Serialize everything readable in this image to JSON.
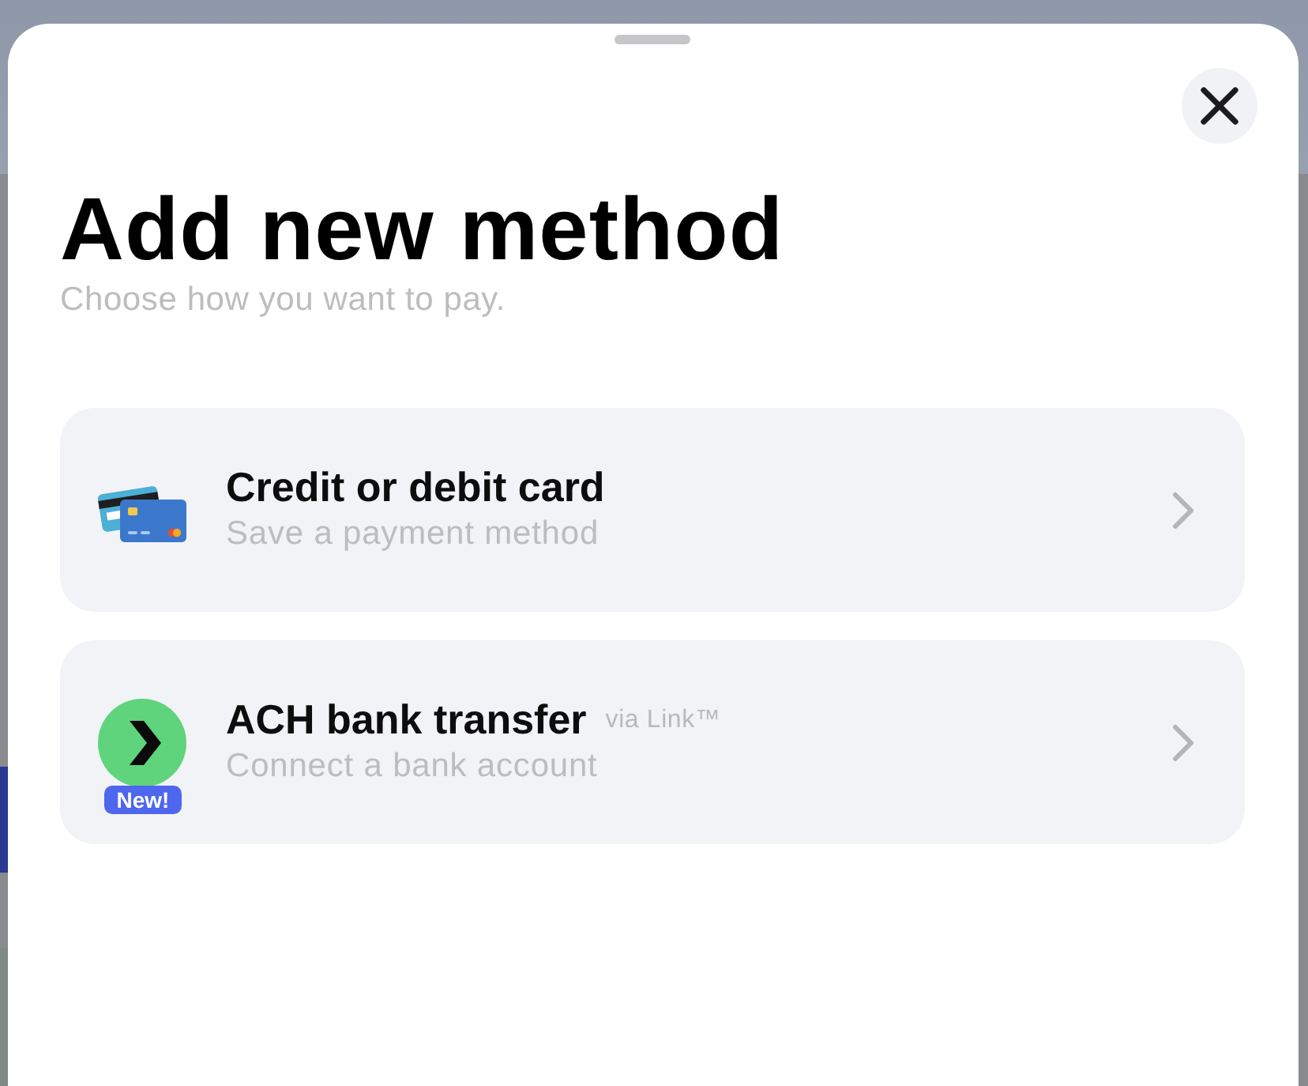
{
  "sheet": {
    "title": "Add new method",
    "subtitle": "Choose how you want to pay.",
    "methods": [
      {
        "kind": "card",
        "title": "Credit or debit card",
        "subtitle": "Save a payment method"
      },
      {
        "kind": "bank",
        "title": "ACH bank transfer",
        "provider": "via Link™",
        "subtitle": "Connect a bank account",
        "badge": "New!"
      }
    ]
  }
}
